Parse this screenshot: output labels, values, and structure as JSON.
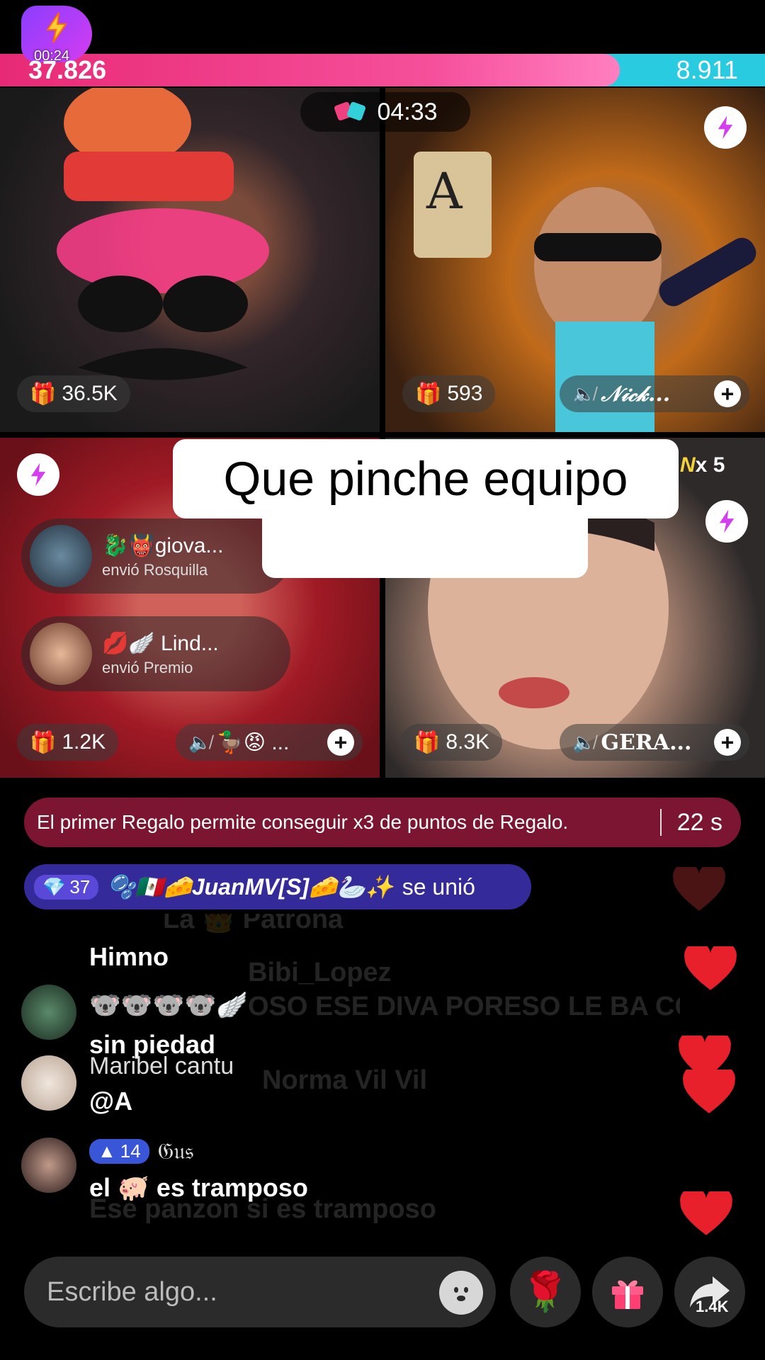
{
  "battle": {
    "elapsed": "00:24",
    "score_left": "37.826",
    "score_right": "8.911",
    "round_timer": "04:33",
    "left_fraction": 0.81
  },
  "tiles": [
    {
      "viewers": "36.5K",
      "name": ""
    },
    {
      "viewers": "593",
      "name": "𝒩𝒾𝒸𝓀..."
    },
    {
      "viewers": "1.2K",
      "name": "🦆😡 ..."
    },
    {
      "viewers": "8.3K",
      "name": "GERA..."
    }
  ],
  "win_badge": {
    "prefix": "N",
    "count": "x 5"
  },
  "caption": {
    "line1": "Que pinche equipo",
    "line2": "😱😱😱😱😱"
  },
  "gifts": [
    {
      "user": "🐉👹giova...",
      "action": "envió Rosquilla"
    },
    {
      "user": "💋🪽 Lind...",
      "action": "envió Premio"
    }
  ],
  "banner": {
    "text": "El primer Regalo permite conseguir x3 de puntos de Regalo.",
    "seconds": "22 s"
  },
  "join": {
    "level": "37",
    "user": "🫧🇲🇽🧀JuanMV[S]🧀🦢✨",
    "action": "se unió"
  },
  "chat": {
    "ghost_lines": [
      "La 👑 Patrona",
      "Bibi_Lopez",
      "OSO ESE DIVA PORESO LE BA COMO",
      "Norma Vil Vil",
      "Ese panzon si es tramposo"
    ],
    "messages": [
      {
        "text": "Himno"
      },
      {
        "text": "🐨🐨🐨🐨🪽"
      },
      {
        "text": "sin piedad"
      },
      {
        "name": "Maribel cantu",
        "text": "@A"
      },
      {
        "level": "14",
        "name": "𝔊𝔲𝔰",
        "text": "el 🐖 es tramposo"
      }
    ]
  },
  "bottom": {
    "placeholder": "Escribe algo...",
    "share_count": "1.4K"
  },
  "colors": {
    "battle_pink": "#e82a76",
    "battle_cyan": "#28cbe0",
    "banner": "#7c1531",
    "join": "#352a9a",
    "heart": "#e8202c"
  }
}
